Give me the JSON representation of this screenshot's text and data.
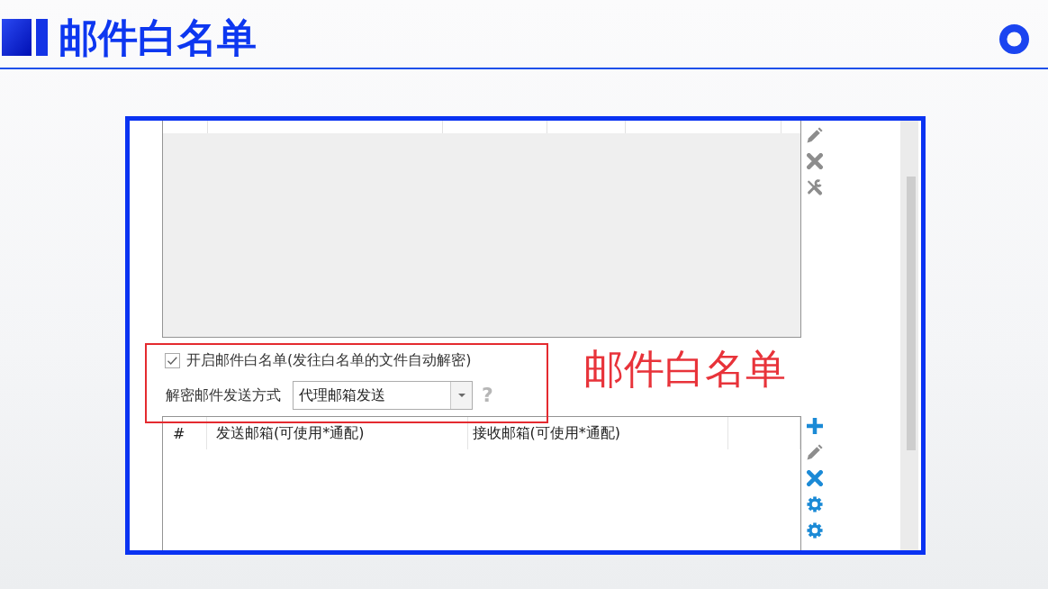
{
  "header": {
    "title": "邮件白名单"
  },
  "dialog": {
    "rules_toolbar": [
      {
        "kind": "edit",
        "disabled": true
      },
      {
        "kind": "delete",
        "disabled": true
      },
      {
        "kind": "tools",
        "disabled": true
      }
    ],
    "whitelist_toggle": {
      "label": "开启邮件白名单(发往白名单的文件自动解密)",
      "checked": true
    },
    "send_method": {
      "label": "解密邮件发送方式",
      "value": "代理邮箱发送",
      "help": "?"
    },
    "whitelist_table": {
      "columns": [
        "#",
        "发送邮箱(可使用*通配)",
        "接收邮箱(可使用*通配)"
      ]
    },
    "whitelist_toolbar": [
      {
        "kind": "add",
        "disabled": false
      },
      {
        "kind": "edit",
        "disabled": true
      },
      {
        "kind": "delete",
        "disabled": false
      },
      {
        "kind": "settings",
        "disabled": false
      },
      {
        "kind": "settings",
        "disabled": false
      }
    ]
  },
  "annotation": {
    "text": "邮件白名单"
  }
}
